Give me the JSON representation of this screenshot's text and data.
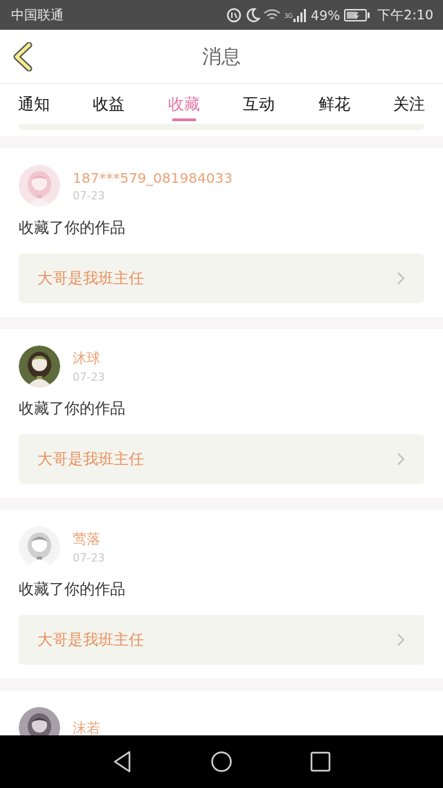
{
  "status_bar": {
    "carrier": "中国联通",
    "network": "3G",
    "battery": "49%",
    "time": "下午2:10"
  },
  "header": {
    "title": "消息"
  },
  "tabs": [
    {
      "label": "通知",
      "selected": false
    },
    {
      "label": "收益",
      "selected": false
    },
    {
      "label": "收藏",
      "selected": true
    },
    {
      "label": "互动",
      "selected": false
    },
    {
      "label": "鲜花",
      "selected": false
    },
    {
      "label": "关注",
      "selected": false
    }
  ],
  "messages": [
    {
      "user": "187***579_081984033",
      "date": "07-23",
      "action": "收藏了你的作品",
      "work": "大哥是我班主任"
    },
    {
      "user": "沐球",
      "date": "07-23",
      "action": "收藏了你的作品",
      "work": "大哥是我班主任"
    },
    {
      "user": "莺落",
      "date": "07-23",
      "action": "收藏了你的作品",
      "work": "大哥是我班主任"
    },
    {
      "user": "沫若"
    }
  ]
}
